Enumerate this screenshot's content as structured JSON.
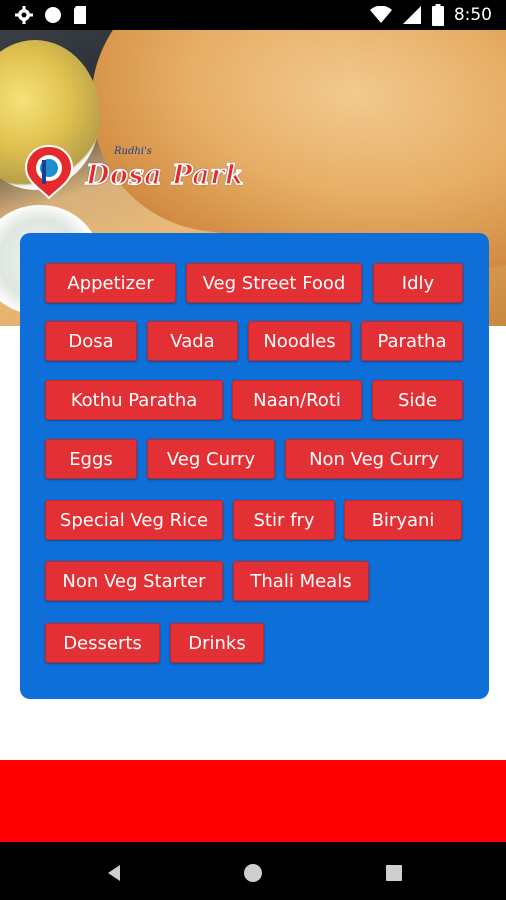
{
  "status_bar": {
    "time": "8:50",
    "icons_left": [
      "gear-icon",
      "circle-icon",
      "sd-card-icon"
    ],
    "icons_right": [
      "wifi-icon",
      "signal-icon",
      "battery-icon"
    ]
  },
  "header": {
    "logo_small_text": "Rudhi's",
    "logo_brand": "Dosa Park"
  },
  "menu_categories": [
    "Appetizer",
    "Veg Street Food",
    "Idly",
    "Dosa",
    "Vada",
    "Noodles",
    "Paratha",
    "Kothu Paratha",
    "Naan/Roti",
    "Side",
    "Eggs",
    "Veg Curry",
    "Non Veg Curry",
    "Special Veg Rice",
    "Stir fry",
    "Biryani",
    "Non Veg Starter",
    "Thali Meals",
    "Desserts",
    "Drinks"
  ],
  "colors": {
    "panel": "#0f6fd9",
    "button": "#e23034",
    "footer_band": "#ff0000"
  },
  "nav_bar": {
    "icons": [
      "back-icon",
      "home-icon",
      "recents-icon"
    ]
  }
}
